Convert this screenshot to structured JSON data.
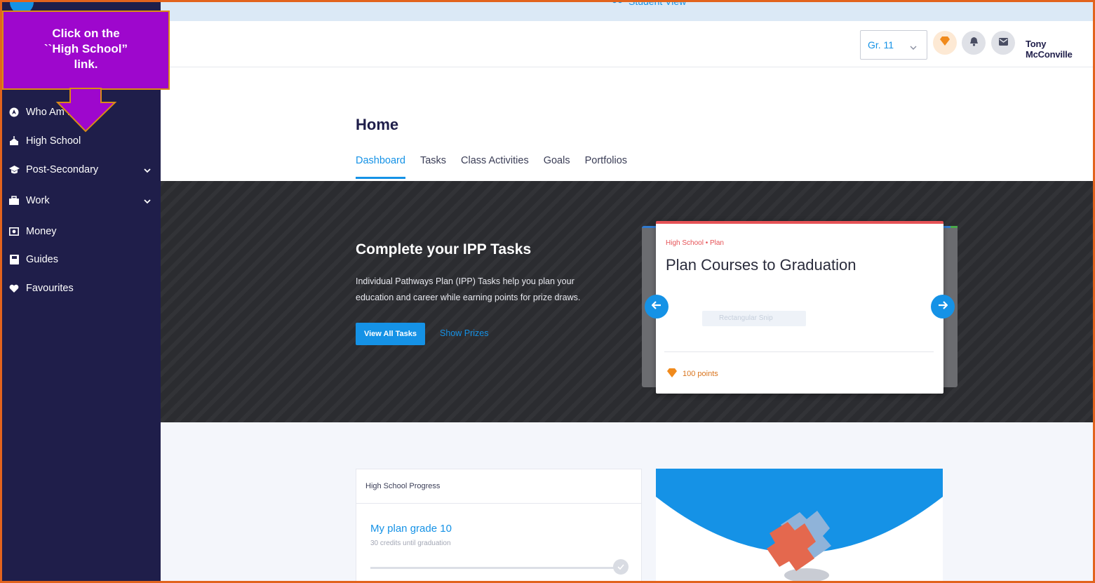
{
  "callout": {
    "text": "Click on the\n``High School”\nlink."
  },
  "sidebar": {
    "items": [
      {
        "label": "Who Am I",
        "icon": "compass-icon"
      },
      {
        "label": "High School",
        "icon": "school-icon"
      },
      {
        "label": "Post-Secondary",
        "icon": "graduation-cap-icon",
        "has_submenu": true
      },
      {
        "label": "Work",
        "icon": "briefcase-icon",
        "has_submenu": true
      },
      {
        "label": "Money",
        "icon": "money-icon"
      },
      {
        "label": "Guides",
        "icon": "book-icon"
      },
      {
        "label": "Favourites",
        "icon": "heart-icon"
      }
    ]
  },
  "student_bar": {
    "label": "Student View"
  },
  "header": {
    "grade": "Gr. 11",
    "user_name": "Tony McConville"
  },
  "main": {
    "title": "Home",
    "tabs": [
      {
        "label": "Dashboard",
        "active": true
      },
      {
        "label": "Tasks"
      },
      {
        "label": "Class Activities"
      },
      {
        "label": "Goals"
      },
      {
        "label": "Portfolios"
      }
    ]
  },
  "banner": {
    "title": "Complete your IPP Tasks",
    "text": "Individual Pathways Plan (IPP) Tasks help you plan your education and career while earning points for prize draws.",
    "primary_button": "View All Tasks",
    "secondary_link": "Show Prizes"
  },
  "task_card": {
    "category": "High School • Plan",
    "title": "Plan Courses to Graduation",
    "ghost_label": "Rectangular Snip",
    "points": "100 points"
  },
  "progress_card": {
    "header": "High School Progress",
    "plan_name": "My plan grade 10",
    "subtitle": "30 credits until graduation"
  },
  "colors": {
    "sidebar_bg": "#1f1e4a",
    "accent": "#1592e6",
    "callout_bg": "#9e07cd",
    "frame": "#e2631d",
    "points": "#d9731b"
  }
}
